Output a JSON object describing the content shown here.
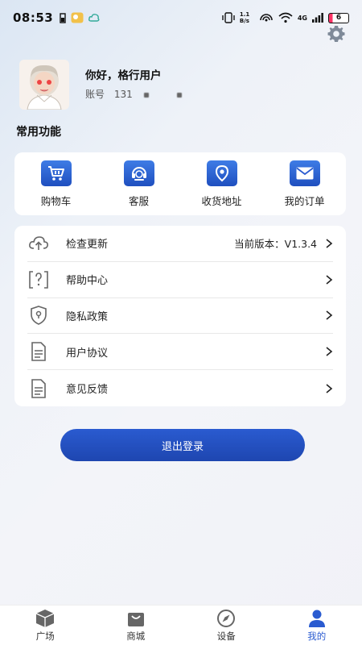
{
  "status_bar": {
    "time": "08:53",
    "network_speed": "1.1 B/s",
    "signal": "4G",
    "battery": "6"
  },
  "profile": {
    "greeting": "你好，格行用户",
    "account_label": "账号",
    "account_number": "131"
  },
  "common_functions": {
    "title": "常用功能",
    "items": [
      {
        "label": "购物车",
        "icon": "shopping-cart-icon"
      },
      {
        "label": "客服",
        "icon": "customer-service-icon"
      },
      {
        "label": "收货地址",
        "icon": "location-pin-icon"
      },
      {
        "label": "我的订单",
        "icon": "mail-icon"
      }
    ]
  },
  "menu": {
    "items": [
      {
        "label": "检查更新",
        "icon": "cloud-upload-icon",
        "value": "当前版本：V1.3.4"
      },
      {
        "label": "帮助中心",
        "icon": "help-icon",
        "value": ""
      },
      {
        "label": "隐私政策",
        "icon": "shield-icon",
        "value": ""
      },
      {
        "label": "用户协议",
        "icon": "document-icon",
        "value": ""
      },
      {
        "label": "意见反馈",
        "icon": "document-icon",
        "value": ""
      }
    ]
  },
  "logout_label": "退出登录",
  "tabs": [
    {
      "label": "广场",
      "icon": "cube-icon",
      "active": false
    },
    {
      "label": "商城",
      "icon": "shopping-bag-icon",
      "active": false
    },
    {
      "label": "设备",
      "icon": "compass-icon",
      "active": false
    },
    {
      "label": "我的",
      "icon": "person-icon",
      "active": true
    }
  ],
  "colors": {
    "accent": "#2a5bd0"
  }
}
